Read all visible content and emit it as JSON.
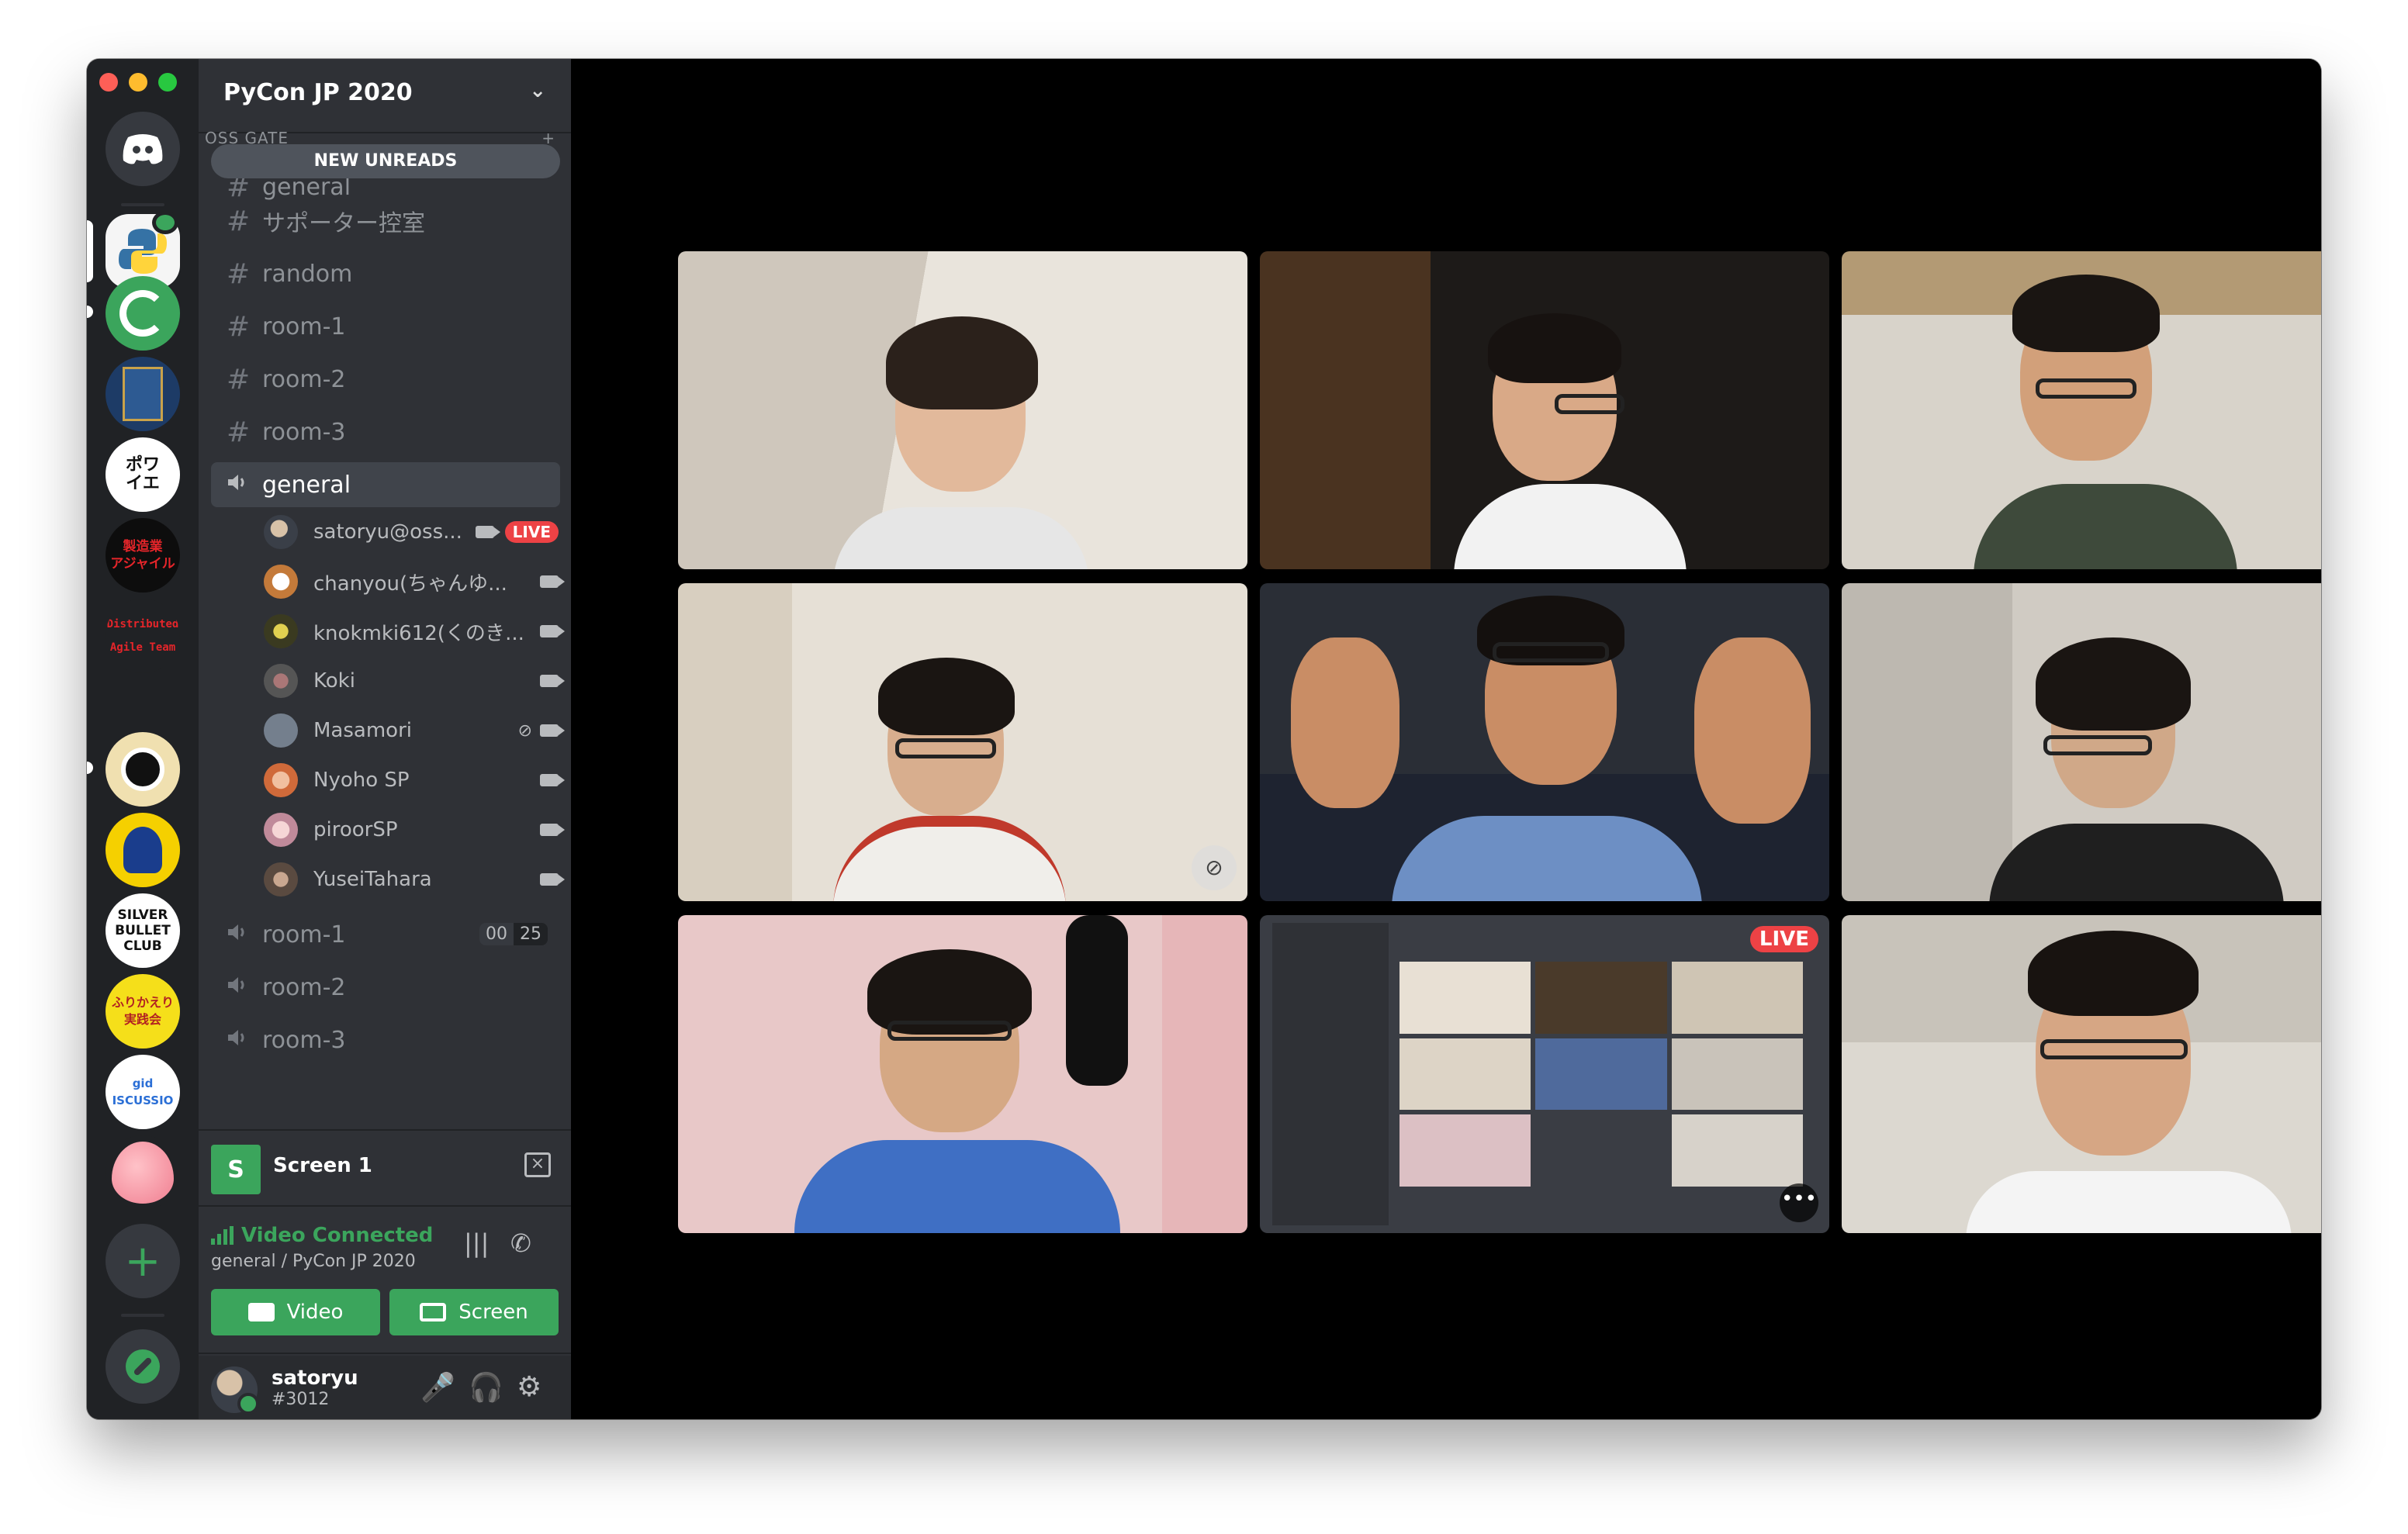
{
  "guild": {
    "name": "PyCon JP 2020",
    "category": "OSS GATE",
    "new_unreads": "NEW UNREADS"
  },
  "text_channels": [
    {
      "name": "general"
    },
    {
      "name": "サポーター控室"
    },
    {
      "name": "random"
    },
    {
      "name": "room-1"
    },
    {
      "name": "room-2"
    },
    {
      "name": "room-3"
    }
  ],
  "voice_general": {
    "name": "general",
    "members": [
      {
        "name": "satoryu@oss...",
        "live": "LIVE"
      },
      {
        "name": "chanyou(ちゃんゆ..."
      },
      {
        "name": "knokmki612(くのき..."
      },
      {
        "name": "Koki"
      },
      {
        "name": "Masamori"
      },
      {
        "name": "Nyoho SP"
      },
      {
        "name": "piroorSP"
      },
      {
        "name": "YuseiTahara"
      }
    ]
  },
  "voice_channels": [
    {
      "name": "room-1",
      "count_a": "00",
      "count_b": "25"
    },
    {
      "name": "room-2"
    },
    {
      "name": "room-3"
    }
  ],
  "servers": [
    {
      "icon": "discord-home-icon"
    },
    {
      "icon": "python-icon"
    },
    {
      "icon": "g-logo-icon"
    },
    {
      "icon": "book-icon"
    },
    {
      "icon": "poi-text",
      "label": "ポワ\nイエ"
    },
    {
      "icon": "agile-text",
      "label": "製造業\nアジャイル"
    },
    {
      "icon": "distributed-text",
      "label": "Distributed\nAgile Team"
    },
    {
      "icon": "avatar-icon"
    },
    {
      "icon": "avatar-icon"
    },
    {
      "icon": "silver-text",
      "label": "SILVER\nBULLET\nCLUB"
    },
    {
      "icon": "furikaeri-text",
      "label": "ふりかえり\n実践会"
    },
    {
      "icon": "discussion-text",
      "label": "gid\nISCUSSIO"
    },
    {
      "icon": "peach-icon"
    },
    {
      "icon": "add-server-icon"
    },
    {
      "icon": "explore-icon"
    }
  ],
  "screen_panel": {
    "thumb": "S",
    "name": "Screen 1"
  },
  "voice_connection": {
    "status": "Video Connected",
    "location": "general / PyCon JP 2020",
    "video_label": "Video",
    "screen_label": "Screen"
  },
  "user": {
    "name": "satoryu",
    "tag": "#3012"
  },
  "stage_labels": {
    "live": "LIVE",
    "more": "•••"
  },
  "colors": {
    "accent": "#3ba55c",
    "live": "#ed4245",
    "sidebar": "#2f3136",
    "rail": "#202225"
  }
}
